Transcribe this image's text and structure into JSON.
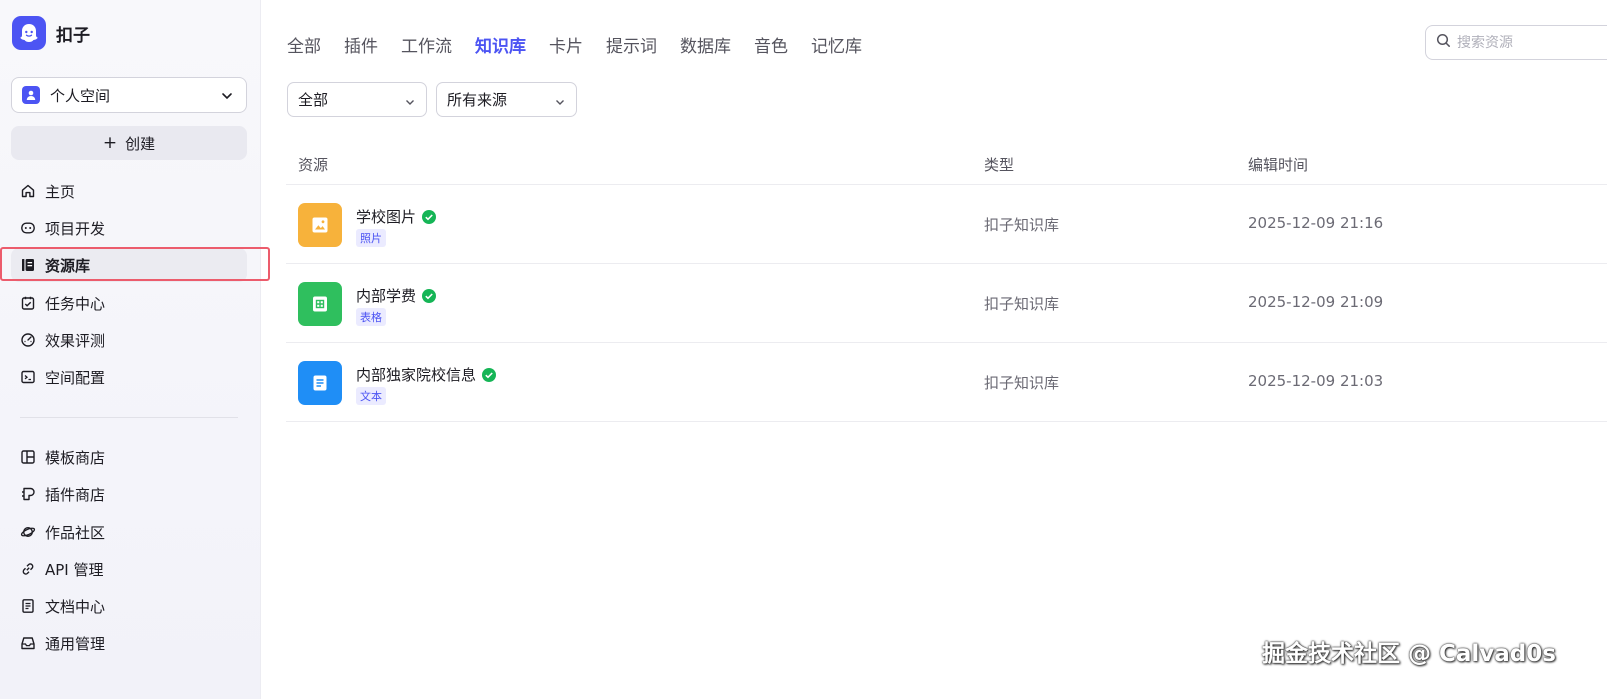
{
  "brand": {
    "name": "扣子",
    "color": "#4c54f3"
  },
  "space": {
    "label": "个人空间"
  },
  "create": {
    "label": "创建"
  },
  "nav": {
    "home": "主页",
    "project": "项目开发",
    "resource": "资源库",
    "task": "任务中心",
    "evaluate": "效果评测",
    "space_config": "空间配置",
    "template": "模板商店",
    "plugin_store": "插件商店",
    "community": "作品社区",
    "api": "API 管理",
    "docs": "文档中心",
    "general": "通用管理"
  },
  "tabs": [
    "全部",
    "插件",
    "工作流",
    "知识库",
    "卡片",
    "提示词",
    "数据库",
    "音色",
    "记忆库"
  ],
  "active_tab": "知识库",
  "search": {
    "placeholder": "搜索资源"
  },
  "filters": {
    "type": "全部",
    "source": "所有来源"
  },
  "table": {
    "headers": {
      "resource": "资源",
      "type": "类型",
      "time": "编辑时间"
    },
    "rows": [
      {
        "name": "学校图片",
        "tag": "照片",
        "type": "扣子知识库",
        "time": "2025-12-09 21:16",
        "icon": "image-icon",
        "color": "#f7b23b"
      },
      {
        "name": "内部学费",
        "tag": "表格",
        "type": "扣子知识库",
        "time": "2025-12-09 21:09",
        "icon": "table-icon",
        "color": "#2fbf5e"
      },
      {
        "name": "内部独家院校信息",
        "tag": "文本",
        "type": "扣子知识库",
        "time": "2025-12-09 21:03",
        "icon": "document-icon",
        "color": "#1f8ef6"
      }
    ]
  },
  "watermark": "掘金技术社区 @ Calvad0s"
}
